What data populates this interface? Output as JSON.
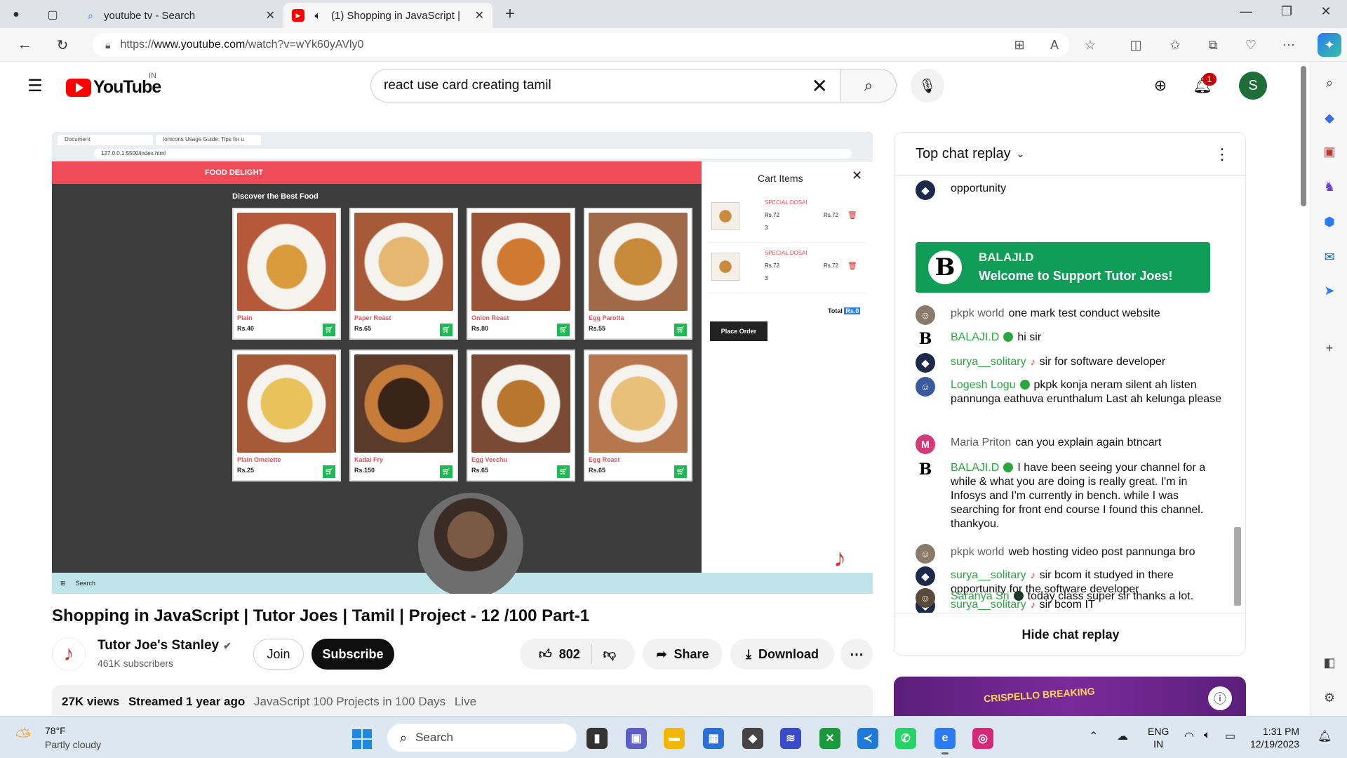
{
  "browser": {
    "tabs": [
      {
        "title": "youtube tv - Search",
        "icon": "search-icon"
      },
      {
        "title": "(1) Shopping in JavaScript |",
        "icon": "youtube-icon"
      }
    ],
    "url_prefix": "https://",
    "url_host": "www.youtube.com",
    "url_path": "/watch?v=wYk60yAVly0"
  },
  "youtube": {
    "logo_text": "YouTube",
    "region": "IN",
    "search_value": "react use card creating tamil",
    "notifications": "1",
    "avatar_letter": "S"
  },
  "video_content": {
    "app_title": "FOOD DELIGHT",
    "subtitle": "Discover the Best Food",
    "foods": [
      {
        "name": "Plain",
        "price": "Rs.40"
      },
      {
        "name": "Paper Roast",
        "price": "Rs.65"
      },
      {
        "name": "Onion Roast",
        "price": "Rs.80"
      },
      {
        "name": "Egg Parotta",
        "price": "Rs.55"
      },
      {
        "name": "Plain Omelette",
        "price": "Rs.25"
      },
      {
        "name": "Kadai Fry",
        "price": "Rs.150"
      },
      {
        "name": "Egg Veechu",
        "price": "Rs.65"
      },
      {
        "name": "Egg Roast",
        "price": "Rs.65"
      }
    ],
    "cart_title": "Cart Items",
    "cart_items": [
      {
        "name": "SPECIAL DOSAI",
        "price": "Rs.72",
        "total": "Rs.72",
        "qty": "3"
      },
      {
        "name": "SPECIAL DOSAI",
        "price": "Rs.72",
        "total": "Rs.72",
        "qty": "3"
      }
    ],
    "total_label": "Total",
    "total_value": "Rs.0",
    "place_order": "Place Order",
    "inner_tabs": [
      "Document",
      "Ionicons Usage Guide: Tips for u"
    ],
    "inner_url": "127.0.0.1:5500/index.html",
    "inner_taskbar_search": "Search"
  },
  "video": {
    "title": "Shopping in JavaScript | Tutor Joes | Tamil | Project - 12 /100 Part-1",
    "channel": "Tutor Joe's Stanley",
    "subscribers": "461K subscribers",
    "join": "Join",
    "subscribe": "Subscribe",
    "likes": "802",
    "share": "Share",
    "download": "Download",
    "views": "27K views",
    "streamed": "Streamed 1 year ago",
    "tags": [
      "JavaScript 100 Projects in 100 Days",
      "Live"
    ]
  },
  "chat": {
    "header": "Top chat replay",
    "clipped_text": "opportunity",
    "membership": {
      "author": "BALAJI.D",
      "text": "Welcome to Support Tutor Joes!"
    },
    "messages": [
      {
        "author": "pkpk world",
        "text": "one mark test conduct website",
        "mod": false
      },
      {
        "author": "BALAJI.D",
        "text": "hi sir",
        "mod": true
      },
      {
        "author": "surya__solitary",
        "text": "sir for software developer",
        "mod": true
      },
      {
        "author": "Logesh Logu",
        "text": "pkpk konja neram silent ah listen pannunga eathuva erunthalum Last ah kelunga please",
        "mod": true
      },
      {
        "author": "Maria Priton",
        "text": "can you explain again btncart",
        "mod": false
      },
      {
        "author": "BALAJI.D",
        "text": "I have been seeing your channel for a while & what you are doing is really great. I'm in Infosys and I'm currently in bench. while I was searching for front end course I found this channel. thankyou.",
        "mod": true
      },
      {
        "author": "pkpk world",
        "text": "web hosting video post pannunga bro",
        "mod": false
      },
      {
        "author": "surya__solitary",
        "text": "sir bcom it studyed in there opportunity for the software developer",
        "mod": true
      },
      {
        "author": "surya__solitary",
        "text": "sir bcom IT",
        "mod": true
      },
      {
        "author": "Saranya Sri",
        "text": "today class super sir thanks a lot.",
        "mod": true
      }
    ],
    "hide": "Hide chat replay"
  },
  "ad": {
    "text": "CRISPELLO BREAKING"
  },
  "taskbar": {
    "temp": "78°F",
    "weather": "Partly cloudy",
    "search": "Search",
    "lang1": "ENG",
    "lang2": "IN",
    "time": "1:31 PM",
    "date": "12/19/2023"
  },
  "colors": {
    "youtube_red": "#ff0000",
    "member_green": "#0f9d58",
    "moderator_green": "#2ba640",
    "food_red": "#ef4b58"
  }
}
